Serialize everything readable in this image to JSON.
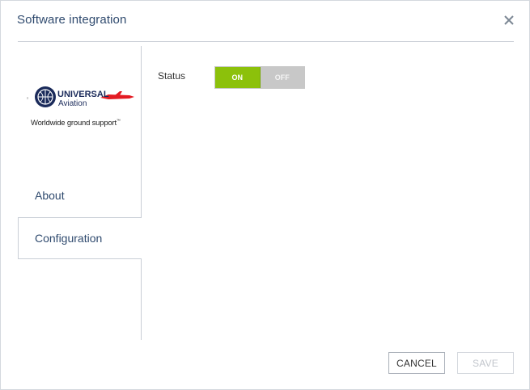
{
  "dialog": {
    "title": "Software integration",
    "close_icon": "close-icon"
  },
  "sidebar": {
    "logo": {
      "brand_line1": "UNIVERSAL",
      "brand_line2": "Aviation",
      "tagline": "Worldwide ground support",
      "tagline_mark": "™",
      "brand_color": "#1a2a5a",
      "accent_color": "#e31b23"
    },
    "items": [
      {
        "label": "About",
        "selected": false
      },
      {
        "label": "Configuration",
        "selected": true
      }
    ]
  },
  "main": {
    "status_label": "Status",
    "toggle": {
      "on_label": "ON",
      "off_label": "OFF",
      "value": "ON",
      "on_color": "#8cc10b",
      "off_color": "#c8c8c8"
    }
  },
  "footer": {
    "cancel_label": "CANCEL",
    "save_label": "SAVE",
    "save_enabled": false
  }
}
